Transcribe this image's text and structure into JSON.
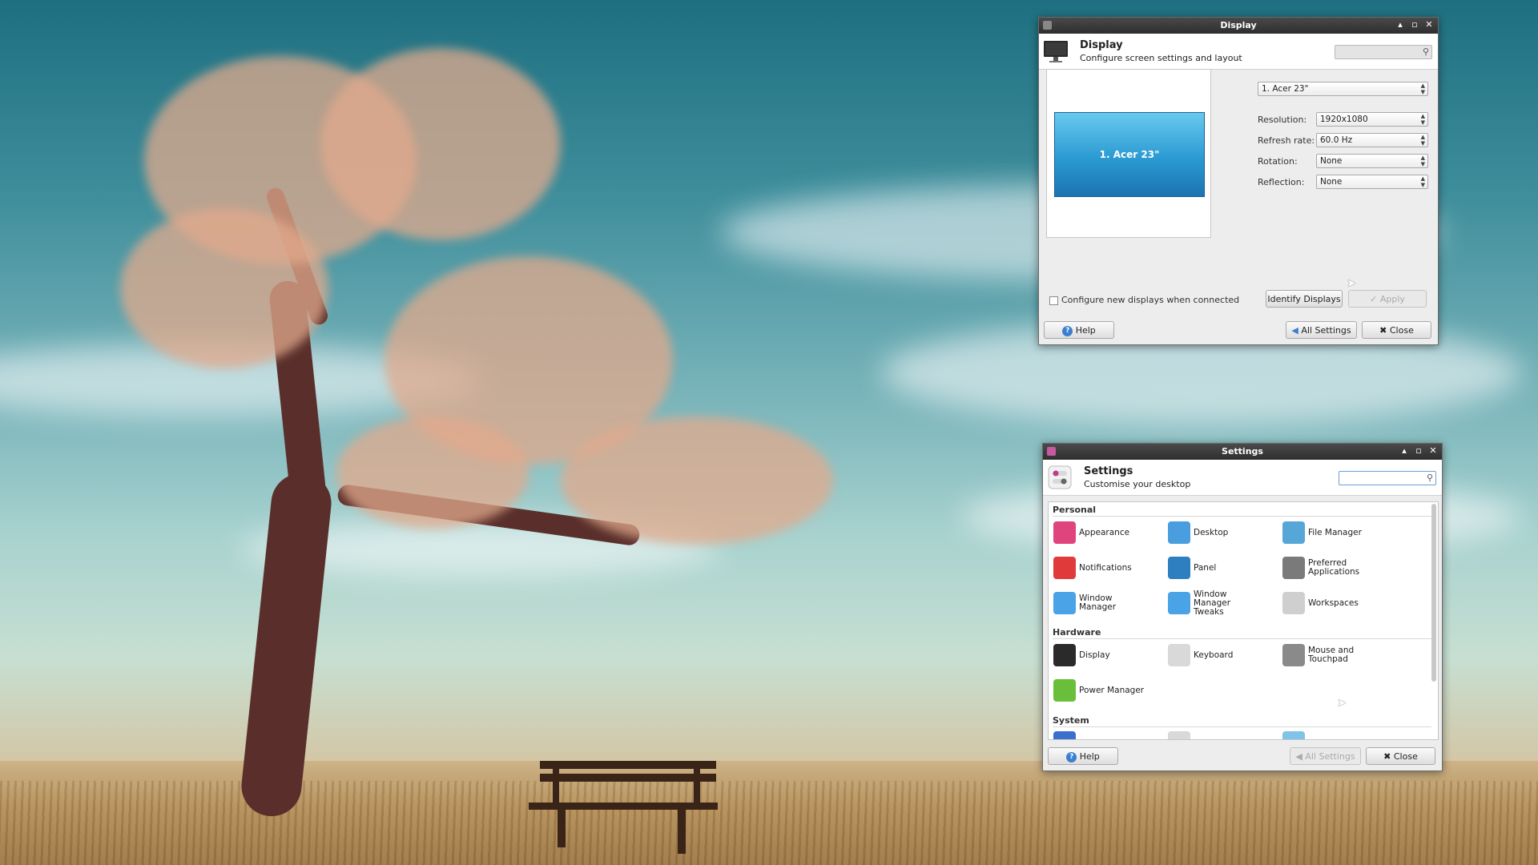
{
  "display_window": {
    "title": "Display",
    "header_title": "Display",
    "header_subtitle": "Configure screen settings and layout",
    "monitor_select": "1. Acer 23\"",
    "monitor_preview_label": "1. Acer 23\"",
    "fields": [
      {
        "label": "Resolution:",
        "value": "1920x1080"
      },
      {
        "label": "Refresh rate:",
        "value": "60.0 Hz"
      },
      {
        "label": "Rotation:",
        "value": "None"
      },
      {
        "label": "Reflection:",
        "value": "None"
      }
    ],
    "configure_new_label": "Configure new displays when connected",
    "identify_label": "Identify Displays",
    "apply_label": "Apply",
    "help_label": "Help",
    "all_settings_label": "All Settings",
    "close_label": "Close"
  },
  "settings_window": {
    "title": "Settings",
    "header_title": "Settings",
    "header_subtitle": "Customise your desktop",
    "sections": [
      {
        "name": "Personal",
        "items": [
          {
            "label": "Appearance",
            "icon": "appearance-icon",
            "color": "#e0447c"
          },
          {
            "label": "Desktop",
            "icon": "desktop-icon",
            "color": "#4a9ee0"
          },
          {
            "label": "File Manager",
            "icon": "file-manager-icon",
            "color": "#56a7d8"
          },
          {
            "label": "Notifications",
            "icon": "notifications-icon",
            "color": "#e03a3a"
          },
          {
            "label": "Panel",
            "icon": "panel-icon",
            "color": "#2e7fc0"
          },
          {
            "label": "Preferred Applications",
            "icon": "preferred-apps-icon",
            "color": "#7a7a7a"
          },
          {
            "label": "Window Manager",
            "icon": "window-manager-icon",
            "color": "#4aa3e6"
          },
          {
            "label": "Window Manager Tweaks",
            "icon": "wm-tweaks-icon",
            "color": "#4aa3e6"
          },
          {
            "label": "Workspaces",
            "icon": "workspaces-icon",
            "color": "#cfcfcf"
          }
        ]
      },
      {
        "name": "Hardware",
        "items": [
          {
            "label": "Display",
            "icon": "display-icon",
            "color": "#2a2a2a"
          },
          {
            "label": "Keyboard",
            "icon": "keyboard-icon",
            "color": "#d9d9d9"
          },
          {
            "label": "Mouse and Touchpad",
            "icon": "mouse-icon",
            "color": "#8a8a8a"
          },
          {
            "label": "Power Manager",
            "icon": "power-manager-icon",
            "color": "#6abf3a"
          }
        ]
      },
      {
        "name": "System",
        "items": []
      }
    ],
    "help_label": "Help",
    "all_settings_label": "All Settings",
    "close_label": "Close"
  }
}
